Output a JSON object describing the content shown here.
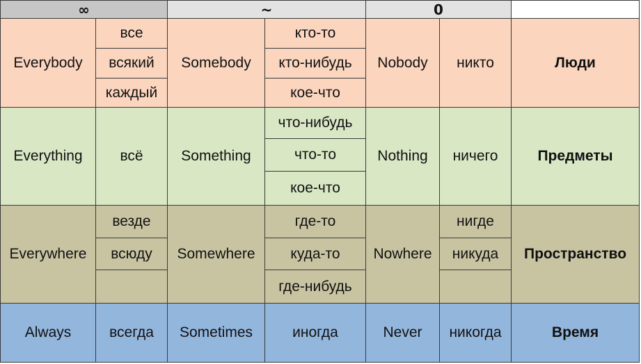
{
  "colors": {
    "header_gray": "#c6c6c6",
    "header_light_gray": "#e2e2e2",
    "header_white": "#ffffff",
    "people_row": "#fbd5be",
    "things_row": "#d9e7c5",
    "place_row": "#c8c4a2",
    "time_row": "#93b6dd"
  },
  "header": {
    "all": "∞",
    "some": "~",
    "none": "0",
    "blank": ""
  },
  "rows": {
    "people": {
      "english_all": "Everybody",
      "russian_all": [
        "все",
        "всякий",
        "каждый"
      ],
      "english_some": "Somebody",
      "russian_some": [
        "кто-то",
        "кто-нибудь",
        "кое-что"
      ],
      "english_none": "Nobody",
      "russian_none": "никто",
      "category": "Люди"
    },
    "things": {
      "english_all": "Everything",
      "russian_all": "всё",
      "english_some": "Something",
      "russian_some": [
        "что-нибудь",
        "что-то",
        "кое-что"
      ],
      "english_none": "Nothing",
      "russian_none": "ничего",
      "category": "Предметы"
    },
    "place": {
      "english_all": "Everywhere",
      "russian_all": [
        "везде",
        "всюду",
        ""
      ],
      "english_some": "Somewhere",
      "russian_some": [
        "где-то",
        "куда-то",
        "где-нибудь"
      ],
      "english_none": "Nowhere",
      "russian_none": [
        "нигде",
        "никуда",
        ""
      ],
      "category": "Пространство"
    },
    "time": {
      "english_all": "Always",
      "russian_all": "всегда",
      "english_some": "Sometimes",
      "russian_some": "иногда",
      "english_none": "Never",
      "russian_none": "никогда",
      "category": "Время"
    }
  }
}
